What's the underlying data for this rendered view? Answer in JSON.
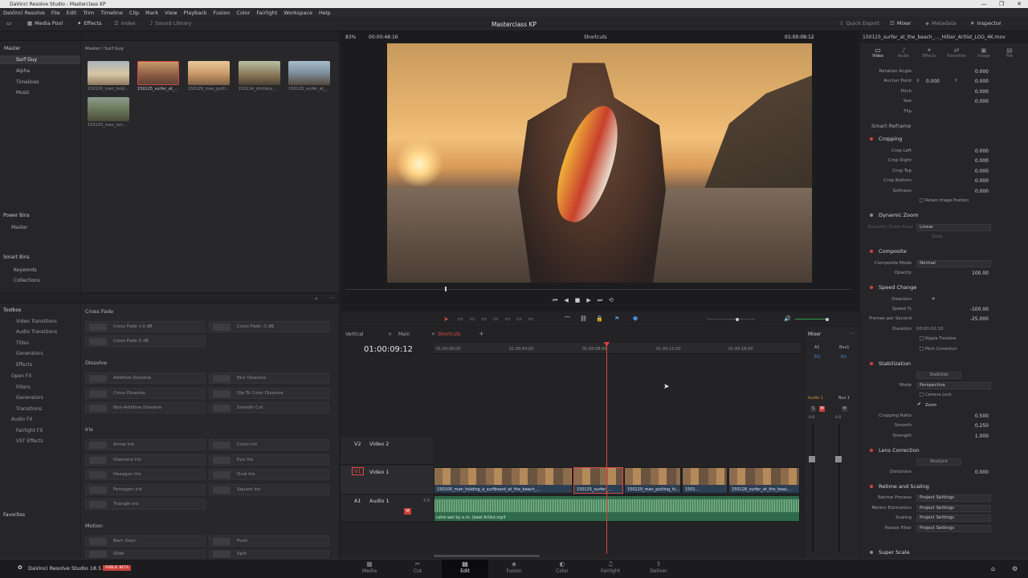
{
  "window": {
    "title": "DaVinci Resolve Studio - Masterclass KP",
    "min": "—",
    "max": "❐",
    "close": "✕"
  },
  "menu": [
    "DaVinci Resolve",
    "File",
    "Edit",
    "Trim",
    "Timeline",
    "Clip",
    "Mark",
    "View",
    "Playback",
    "Fusion",
    "Color",
    "Fairlight",
    "Workspace",
    "Help"
  ],
  "toolbar": {
    "media_pool": "Media Pool",
    "effects": "Effects",
    "index": "Index",
    "sound_library": "Sound Library",
    "project": "Masterclass KP",
    "quick_export": "Quick Export",
    "mixer": "Mixer",
    "metadata": "Metadata",
    "inspector": "Inspector"
  },
  "viewer_bar": {
    "zoom": "83%",
    "src_tc": "00:00:48:16",
    "timeline_name": "Shortcuts",
    "rec_tc": "01:00:09:12",
    "clip_name": "150125_surfer_at_the_beach_..._Hillier_Artlist_LOG_4K.mov"
  },
  "bins": {
    "path": "Master / Surf Guy",
    "master": "Master",
    "items": [
      "Surf Guy",
      "Alpha",
      "Timelines",
      "Music"
    ],
    "power_bins": "Power Bins",
    "power_master": "Master",
    "smart_bins": "Smart Bins",
    "keywords": "Keywords",
    "collections": "Collections",
    "favorites": "Favorites"
  },
  "clips": [
    "150100_man_hold...",
    "150125_surfer_at_...",
    "150129_man_putti...",
    "150114_shirtless_...",
    "150128_surfer_at_...",
    "150103_man_run..."
  ],
  "toolbox": {
    "title": "Toolbox",
    "items": [
      "Video Transitions",
      "Audio Transitions",
      "Titles",
      "Generators",
      "Effects"
    ],
    "openfx": "Open FX",
    "openfx_items": [
      "Filters",
      "Generators",
      "Transitions"
    ],
    "audiofx": "Audio FX",
    "audiofx_items": [
      "Fairlight FX",
      "VST Effects"
    ]
  },
  "effects": {
    "cross_fade": "Cross Fade",
    "cf": [
      "Cross Fade +3 dB",
      "Cross Fade -3 dB",
      "Cross Fade 0 dB"
    ],
    "dissolve": "Dissolve",
    "dis": [
      "Additive Dissolve",
      "Blur Dissolve",
      "Cross Dissolve",
      "Dip To Color Dissolve",
      "Non-Additive Dissolve",
      "Smooth Cut"
    ],
    "iris": "Iris",
    "iris_items": [
      "Arrow Iris",
      "Cross Iris",
      "Diamond Iris",
      "Eye Iris",
      "Hexagon Iris",
      "Oval Iris",
      "Pentagon Iris",
      "Square Iris",
      "Triangle Iris"
    ],
    "motion": "Motion",
    "mot": [
      "Barn Door",
      "Push",
      "Slide",
      "Split"
    ]
  },
  "timeline": {
    "tabs": [
      "Vertical",
      "Main",
      "Shortcuts"
    ],
    "tc": "01:00:09:12",
    "ruler": [
      "01:00:00:00",
      "01:00:04:00",
      "01:00:08:00",
      "01:00:12:00",
      "01:00:16:00"
    ],
    "v2": "V2",
    "v2_name": "Video 2",
    "v1": "V1",
    "v1_name": "Video 1",
    "a1": "A1",
    "a1_name": "Audio 1",
    "a1_ch": "2.0",
    "clips": [
      "150100_man_holding_a_surfboard_at_the_beach_...",
      "150125_surfer_...",
      "150129_man_putting_hi...",
      "1501...",
      "150128_surfer_at_the_beac..."
    ],
    "audio_clip": "rafsk-wel by e.m. (beel Artlist.mp3"
  },
  "mixer": {
    "title": "Mixer",
    "a1": "A1",
    "bus1": "Bus1",
    "eq": "EQ",
    "audio1": "Audio 1",
    "bus1b": "Bus 1",
    "s": "S",
    "m": "M",
    "zero": "0.0"
  },
  "inspector": {
    "tabs": [
      "Video",
      "Audio",
      "Effects",
      "Transition",
      "Image",
      "File"
    ],
    "rotation": "Rotation Angle",
    "rotation_v": "0.000",
    "anchor": "Anchor Point",
    "x": "X",
    "anchor_x": "0.000",
    "y": "Y",
    "anchor_y": "0.000",
    "pitch": "Pitch",
    "pitch_v": "0.000",
    "yaw": "Yaw",
    "yaw_v": "0.000",
    "flip": "Flip",
    "smart_reframe": "Smart Reframe",
    "cropping": "Cropping",
    "crop_left": "Crop Left",
    "crop_right": "Crop Right",
    "crop_top": "Crop Top",
    "crop_bottom": "Crop Bottom",
    "softness": "Softness",
    "crop_v": "0.000",
    "retain": "Retain Image Position",
    "dynamic_zoom": "Dynamic Zoom",
    "dz_ease": "Dynamic Zoom Ease",
    "dz_val": "Linear",
    "dz_swap": "Swap",
    "composite": "Composite",
    "comp_mode": "Composite Mode",
    "comp_val": "Normal",
    "opacity": "Opacity",
    "opacity_v": "100.00",
    "speed_change": "Speed Change",
    "direction": "Direction",
    "speed": "Speed %",
    "speed_v": "-100.00",
    "fps": "Frames per Second",
    "fps_v": "-25.000",
    "duration": "Duration",
    "duration_v": "00:00:02:18",
    "ripple": "Ripple Timeline",
    "pitch_corr": "Pitch Correction",
    "stabilization": "Stabilization",
    "stabilize": "Stabilize",
    "mode": "Mode",
    "mode_v": "Perspective",
    "camera_lock": "Camera Lock",
    "zoom": "Zoom",
    "crop_ratio": "Cropping Ratio",
    "crop_ratio_v": "0.500",
    "smooth": "Smooth",
    "smooth_v": "0.250",
    "strength": "Strength",
    "strength_v": "1.000",
    "lens": "Lens Correction",
    "analyze": "Analyze",
    "distortion": "Distortion",
    "distortion_v": "0.000",
    "retime": "Retime and Scaling",
    "retime_process": "Retime Process",
    "motion_est": "Motion Estimation",
    "scaling": "Scaling",
    "resize_filter": "Resize Filter",
    "ps": "Project Settings",
    "super_scale": "Super Scale"
  },
  "pages": [
    "Media",
    "Cut",
    "Edit",
    "Fusion",
    "Color",
    "Fairlight",
    "Deliver"
  ],
  "brand": {
    "name": "DaVinci Resolve Studio 18.5",
    "badge": "PUBLIC BETA"
  },
  "colors": {
    "accent_red": "#d2433d",
    "playhead": "#e0413a",
    "clip_blue": "#2c4a6a",
    "audio_green": "#2f6a4a",
    "timeline_bg": "#232326"
  }
}
